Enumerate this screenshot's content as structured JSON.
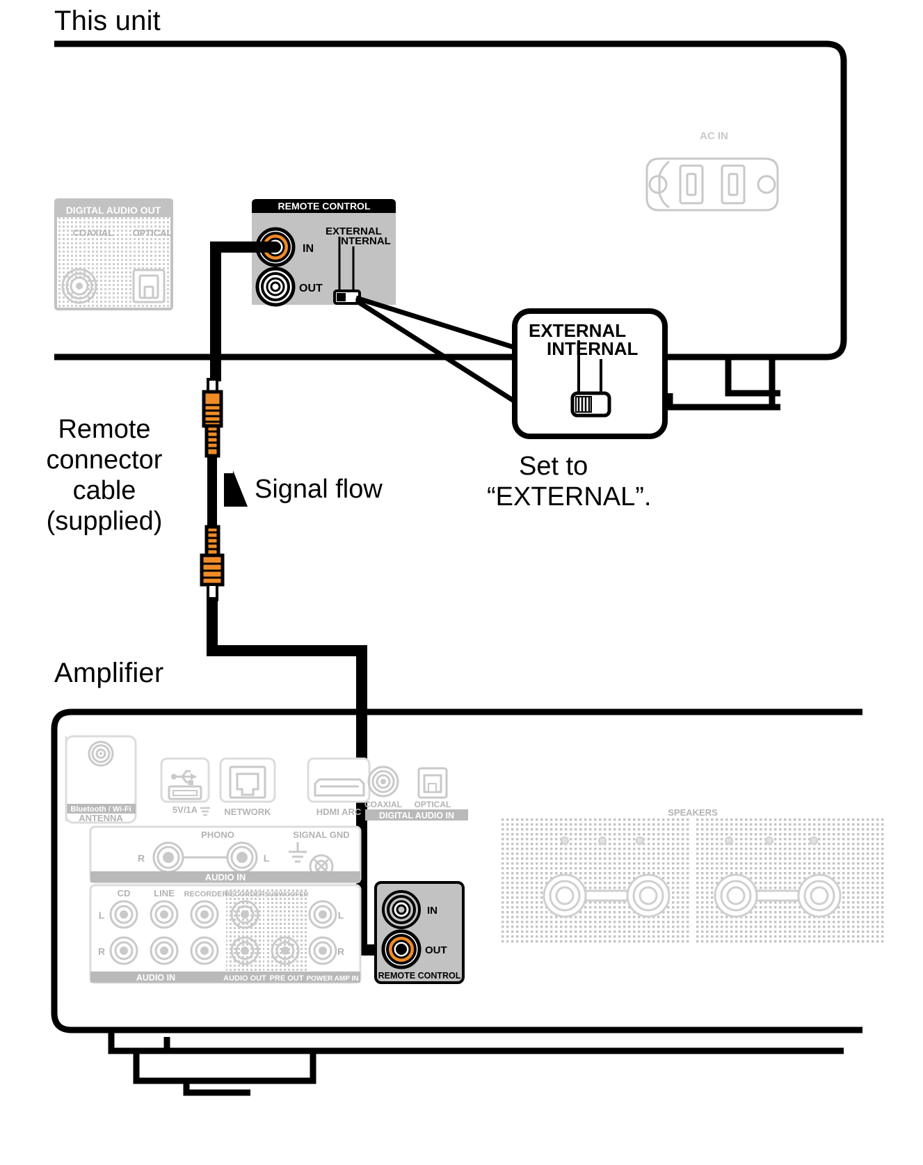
{
  "page": {
    "headings": {
      "this_unit": "This unit",
      "amplifier": "Amplifier"
    },
    "annotations": {
      "cable_label": [
        "Remote",
        "connector",
        "cable",
        "(supplied)"
      ],
      "signal_flow": "Signal flow",
      "set_to": [
        "Set to",
        "“EXTERNAL”."
      ]
    }
  },
  "this_unit": {
    "digital_audio_out": {
      "title": "DIGITAL AUDIO OUT",
      "jacks": [
        "COAXIAL",
        "OPTICAL"
      ]
    },
    "ac_in": {
      "label": "AC IN"
    },
    "remote_control": {
      "title": "REMOTE CONTROL",
      "jacks": [
        "IN",
        "OUT"
      ],
      "switch": {
        "options": [
          "EXTERNAL",
          "INTERNAL"
        ],
        "selected": "EXTERNAL"
      }
    }
  },
  "callout": {
    "switch": {
      "options": [
        "EXTERNAL",
        "INTERNAL"
      ],
      "selected": "EXTERNAL"
    }
  },
  "amplifier": {
    "top_row": [
      "Bluetooth / Wi-Fi",
      "ANTENNA",
      "5V/1A",
      "NETWORK",
      "HDMI ARC",
      "COAXIAL",
      "OPTICAL",
      "DIGITAL AUDIO IN"
    ],
    "phono_row": {
      "phono": "PHONO",
      "signal_gnd": "SIGNAL GND",
      "left": "L",
      "right": "R",
      "audio_in": "AUDIO IN"
    },
    "audio_block": {
      "headers": [
        "CD",
        "LINE",
        "RECORDER",
        "RECORDER",
        "SUBWOOFER"
      ],
      "left": "L",
      "right": "R",
      "footers": [
        "AUDIO IN",
        "AUDIO OUT",
        "PRE OUT",
        "POWER AMP IN"
      ]
    },
    "remote_control": {
      "title": "REMOTE CONTROL",
      "jacks": [
        "IN",
        "OUT"
      ]
    },
    "speakers": {
      "title": "SPEAKERS"
    }
  },
  "colors": {
    "accent_orange": "#F08C28",
    "panel_grey": "#C2C2C2",
    "dim_grey": "#C8C8C8",
    "ink": "#000000"
  }
}
